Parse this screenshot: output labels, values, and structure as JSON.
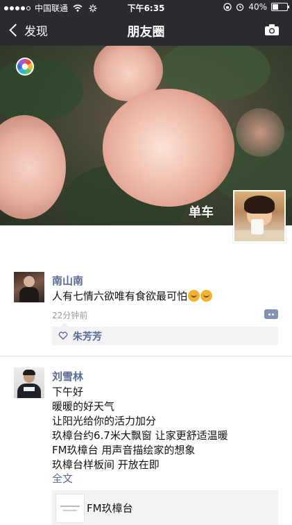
{
  "status_bar": {
    "carrier": "中国联通",
    "time": "下午6:35",
    "battery_level": "40%",
    "battery_fraction": 0.4
  },
  "nav": {
    "back_label": "发现",
    "title": "朋友圈"
  },
  "cover": {
    "user_name": "单车"
  },
  "posts": [
    {
      "author": "南山南",
      "lines": [
        "人有七情六欲唯有食欲最可怕"
      ],
      "emojis": [
        "sweat-smile-emoji",
        "sweat-smile-emoji"
      ],
      "time": "22分钟前",
      "likes": [
        "朱芳芳"
      ]
    },
    {
      "author": "刘雪林",
      "lines": [
        "下午好",
        "暖暖的好天气",
        "让阳光给你的活力加分",
        "玖樟台约6.7米大飘窗 让家更舒适温暖",
        "FM玖樟台 用声音描绘家的想象",
        "玖樟台样板间 开放在即"
      ],
      "expand_label": "全文",
      "link_card": {
        "title": "FM玖樟台"
      }
    }
  ],
  "colors": {
    "nav_bg": "#2b2a2f",
    "name_link": "#576b95",
    "likes_bg": "#f3f3f5",
    "time_gray": "#9a9a9a"
  },
  "icons": {
    "back": "chevron-left-icon",
    "camera": "camera-icon",
    "wifi": "wifi-icon",
    "loading": "activity-spinner-icon",
    "lock": "orientation-lock-icon",
    "alarm": "alarm-icon",
    "battery": "battery-icon",
    "heart": "heart-icon",
    "comment": "comment-more-icon",
    "lens": "lens-color-icon"
  }
}
